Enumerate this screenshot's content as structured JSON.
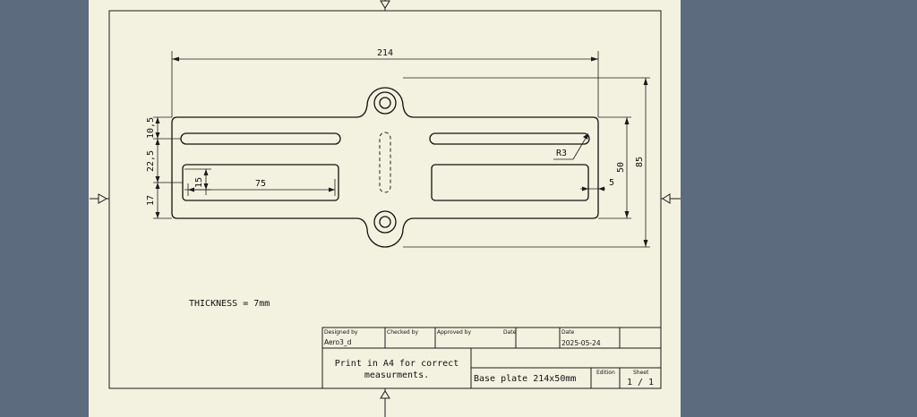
{
  "drawing": {
    "dimensions": {
      "overall_width": "214",
      "overall_height": "85",
      "plate_height": "50",
      "slot_width": "75",
      "slot_height": "15",
      "offset_top": "10,5",
      "offset_mid": "22,5",
      "offset_bottom": "17",
      "edge_offset": "5",
      "corner_radius": "R3"
    },
    "note": "THICKNESS = 7mm"
  },
  "title_block": {
    "designed_by_label": "Designed by",
    "designed_by_value": "Aero3_d",
    "checked_by_label": "Checked by",
    "approved_by_label": "Approved by",
    "date_label_1": "Date",
    "date_label_2": "Date",
    "date_value": "2025-05-24",
    "print_note_line1": "Print in A4 for correct",
    "print_note_line2": "measurments.",
    "title": "Base plate 214x50mm",
    "edition_label": "Edition",
    "sheet_label": "Sheet",
    "sheet_value": "1 / 1"
  },
  "colors": {
    "background": "#5d6b7e",
    "paper": "#f3f2e0",
    "ink": "#1b1b1b"
  }
}
